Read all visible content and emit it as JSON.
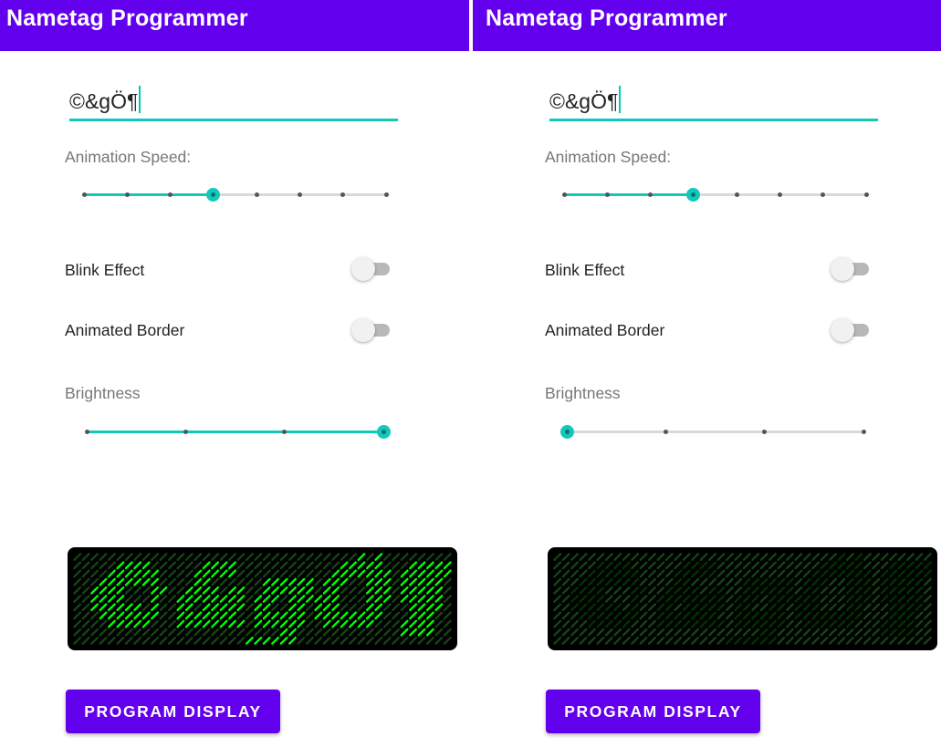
{
  "app": {
    "title": "Nametag Programmer"
  },
  "accent_color": "#12c8bb",
  "primary_color": "#6200ee",
  "led_color": "#00ff00",
  "panels": [
    {
      "text_value": "©&gÖ¶",
      "speed_label": "Animation Speed:",
      "speed_level": 4,
      "speed_steps": 8,
      "blink_label": "Blink Effect",
      "blink_on": false,
      "border_label": "Animated Border",
      "border_on": false,
      "brightness_label": "Brightness",
      "brightness_level": 4,
      "brightness_steps": 4,
      "button_label": "PROGRAM DISPLAY"
    },
    {
      "text_value": "©&gÖ¶",
      "speed_label": "Animation Speed:",
      "speed_level": 4,
      "speed_steps": 8,
      "blink_label": "Blink Effect",
      "blink_on": false,
      "border_label": "Animated Border",
      "border_on": false,
      "brightness_label": "Brightness",
      "brightness_level": 1,
      "brightness_steps": 4,
      "button_label": "PROGRAM DISPLAY"
    }
  ]
}
